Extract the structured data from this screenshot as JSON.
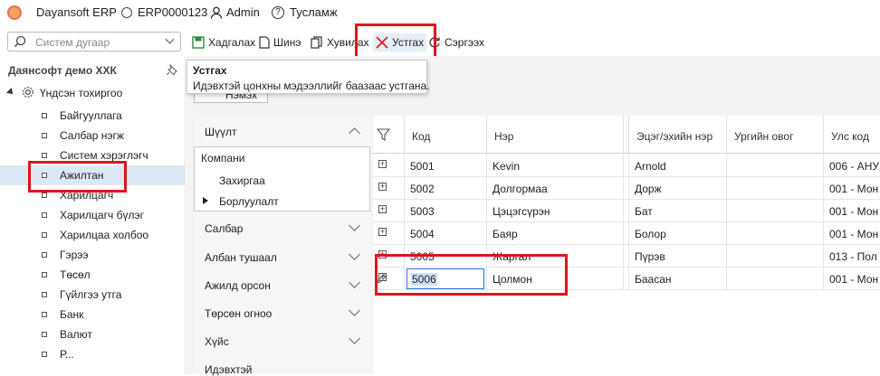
{
  "titlebar": {
    "app_name": "Dayansoft ERP",
    "doc_code": "ERP0000123",
    "user": "Admin",
    "help": "Тусламж"
  },
  "search": {
    "placeholder": "Систем дугаар"
  },
  "toolbar": {
    "save": "Хадгалах",
    "new": "Шинэ",
    "copy": "Хувилах",
    "delete": "Устгах",
    "refresh": "Сэргээх"
  },
  "tooltip": {
    "title": "Устгах",
    "body": "Идэвхтэй цонхны мэдээллийг баазаас устгана."
  },
  "sidebar": {
    "company": "Даянсофт демо ХХК",
    "root": "Үндсэн тохиргоо",
    "items": [
      {
        "label": "Байгууллага"
      },
      {
        "label": "Салбар нэгж"
      },
      {
        "label": "Систем хэрэглэгч"
      },
      {
        "label": "Ажилтан"
      },
      {
        "label": "Харилцагч"
      },
      {
        "label": "Харилцагч бүлэг"
      },
      {
        "label": "Харилцаа холбоо"
      },
      {
        "label": "Гэрээ"
      },
      {
        "label": "Төсөл"
      },
      {
        "label": "Гүйлгээ утга"
      },
      {
        "label": "Банк"
      },
      {
        "label": "Валют"
      },
      {
        "label": "Р..."
      }
    ]
  },
  "hidden_button": "Нэмэх",
  "filters": {
    "title": "Шүүлт",
    "company_label": "Компани",
    "company_items": [
      "Захиргаа",
      "Борлуулалт"
    ],
    "groups": [
      "Салбар",
      "Албан тушаал",
      "Ажилд орсон",
      "Төрсөн огноо",
      "Хүйс",
      "Идэвхтэй"
    ]
  },
  "grid": {
    "columns": [
      "Код",
      "Нэр",
      "Эцэг/эхийн нэр",
      "Ургийн овог",
      "Улс код"
    ],
    "rows": [
      {
        "code": "5001",
        "name": "Kevin",
        "parent": "Arnold",
        "clan": "",
        "country": "006 - АНУ"
      },
      {
        "code": "5002",
        "name": "Долгормаа",
        "parent": "Дорж",
        "clan": "",
        "country": "001 - Мон"
      },
      {
        "code": "5003",
        "name": "Цэцэгсүрэн",
        "parent": "Бат",
        "clan": "",
        "country": "001 - Мон"
      },
      {
        "code": "5004",
        "name": "Баяр",
        "parent": "Болор",
        "clan": "",
        "country": "001 - Мон"
      },
      {
        "code": "5005",
        "name": "Жаргал",
        "parent": "Пүрэв",
        "clan": "",
        "country": "013 - Пол"
      },
      {
        "code": "5006",
        "name": "Цолмон",
        "parent": "Баасан",
        "clan": "",
        "country": "001 - Мон"
      }
    ]
  },
  "colors": {
    "accent_red": "#e0141e",
    "selected_row": "#dde8f6",
    "input_focus": "#2a6fd6"
  }
}
